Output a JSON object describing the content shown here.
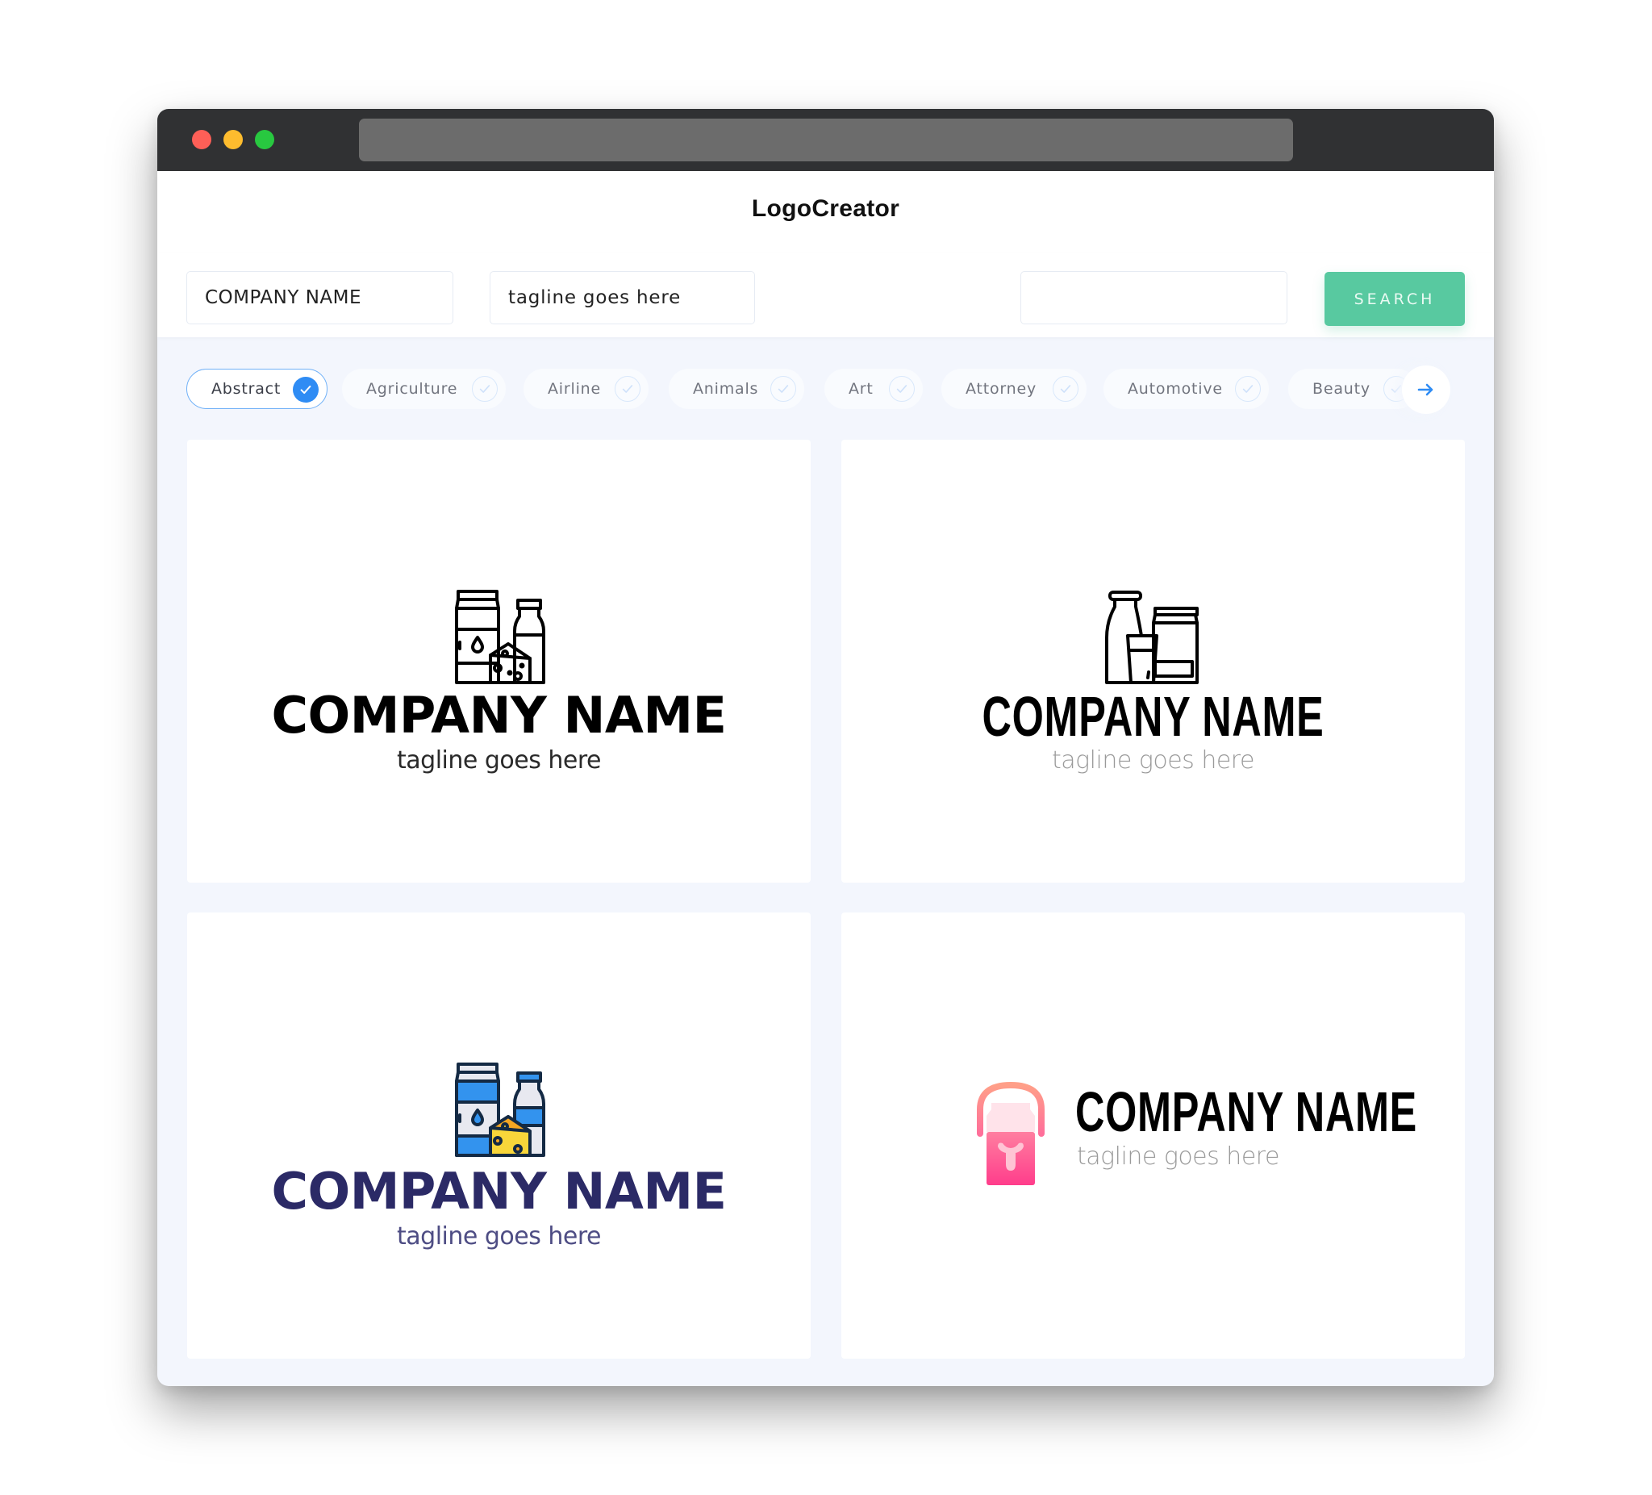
{
  "app": {
    "title": "LogoCreator"
  },
  "search": {
    "company_name_value": "COMPANY NAME",
    "tagline_value": "tagline goes here",
    "keyword_value": "",
    "button_label": "SEARCH"
  },
  "categories": [
    {
      "label": "Abstract",
      "selected": true
    },
    {
      "label": "Agriculture",
      "selected": false
    },
    {
      "label": "Airline",
      "selected": false
    },
    {
      "label": "Animals",
      "selected": false
    },
    {
      "label": "Art",
      "selected": false
    },
    {
      "label": "Attorney",
      "selected": false
    },
    {
      "label": "Automotive",
      "selected": false
    },
    {
      "label": "Beauty",
      "selected": false
    }
  ],
  "next_icon": "arrow-right-icon",
  "logos": [
    {
      "company": "COMPANY NAME",
      "tagline": "tagline goes here",
      "icon": "dairy-products-outline-icon"
    },
    {
      "company": "COMPANY NAME",
      "tagline": "tagline goes here",
      "icon": "milk-bottle-glass-carton-outline-icon"
    },
    {
      "company": "COMPANY NAME",
      "tagline": "tagline goes here",
      "icon": "dairy-products-color-icon"
    },
    {
      "company": "COMPANY NAME",
      "tagline": "tagline goes here",
      "icon": "milk-can-bull-icon"
    }
  ],
  "colors": {
    "accent_green": "#58c9a0",
    "accent_blue": "#2f8cf4",
    "navy": "#2b2a66",
    "pink": "#ff3d8b"
  }
}
